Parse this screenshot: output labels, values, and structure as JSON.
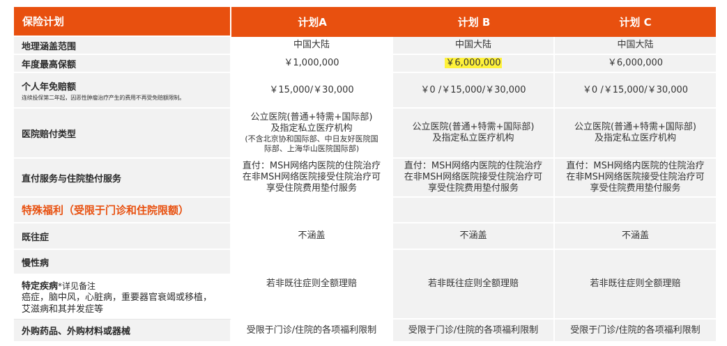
{
  "header": {
    "label": "保险计划",
    "plans": [
      "计划A",
      "计划 B",
      "计划 C"
    ]
  },
  "rows": {
    "coverage": {
      "label": "地理涵盖范围",
      "values": [
        "中国大陆",
        "中国大陆",
        "中国大陆"
      ]
    },
    "annual_max": {
      "label": "年度最高保额",
      "values": [
        "￥1,000,000",
        "￥6,000,000",
        "￥6,000,000"
      ]
    },
    "deductible": {
      "label": "个人年免赔额",
      "note": "连续投保第二年起，因恶性肿瘤治疗产生的费用不再受免赔额限制。",
      "values": [
        "￥15,000/￥30,000",
        "￥0 /￥15,000/￥30,000",
        "￥0 /￥15,000/￥30,000"
      ]
    },
    "hospital": {
      "label": "医院赔付类型",
      "a_line1": "公立医院(普通+特需+国际部)",
      "a_line2": "及指定私立医疗机构",
      "a_note1": "(不含北京协和国际部、中日友好医院国",
      "a_note2": "际部、上海华山医院国际部)",
      "b_line1": "公立医院(普通+特需+国际部)",
      "b_line2": "及指定私立医疗机构",
      "c_line1": "公立医院(普通+特需+国际部)",
      "c_line2": "及指定私立医疗机构"
    },
    "direct_pay": {
      "label": "直付服务与住院垫付服务",
      "line1": "直付：MSH网络内医院的住院治疗",
      "line2": "在非MSH网络医院接受住院治疗可",
      "line3": "享受住院费用垫付服务"
    },
    "special": {
      "title": "特殊福利",
      "suffix": "（受限于门诊和住院限额）"
    },
    "preexisting": {
      "label": "既往症",
      "values": [
        "不涵盖",
        "不涵盖",
        "不涵盖"
      ]
    },
    "chronic": {
      "label": "慢性病"
    },
    "specified": {
      "title": "特定疾病",
      "title_note": "*详见备注",
      "desc1": "癌症，脑中风，心脏病，重要器官衰竭或移植，",
      "desc2": "艾滋病和其并发症等"
    },
    "chronic_specified_values": [
      "若非既往症则全额理赔",
      "若非既往症则全额理赔",
      "若非既往症则全额理赔"
    ],
    "external": {
      "label": "外购药品、外购材料或器械",
      "values": [
        "受限于门诊/住院的各项福利限制",
        "受限于门诊/住院的各项福利限制",
        "受限于门诊/住院的各项福利限制"
      ]
    }
  },
  "colors": {
    "header_bg": "#e8500f",
    "row_bg": "#f2f2f2",
    "highlight": "#fff23a"
  }
}
